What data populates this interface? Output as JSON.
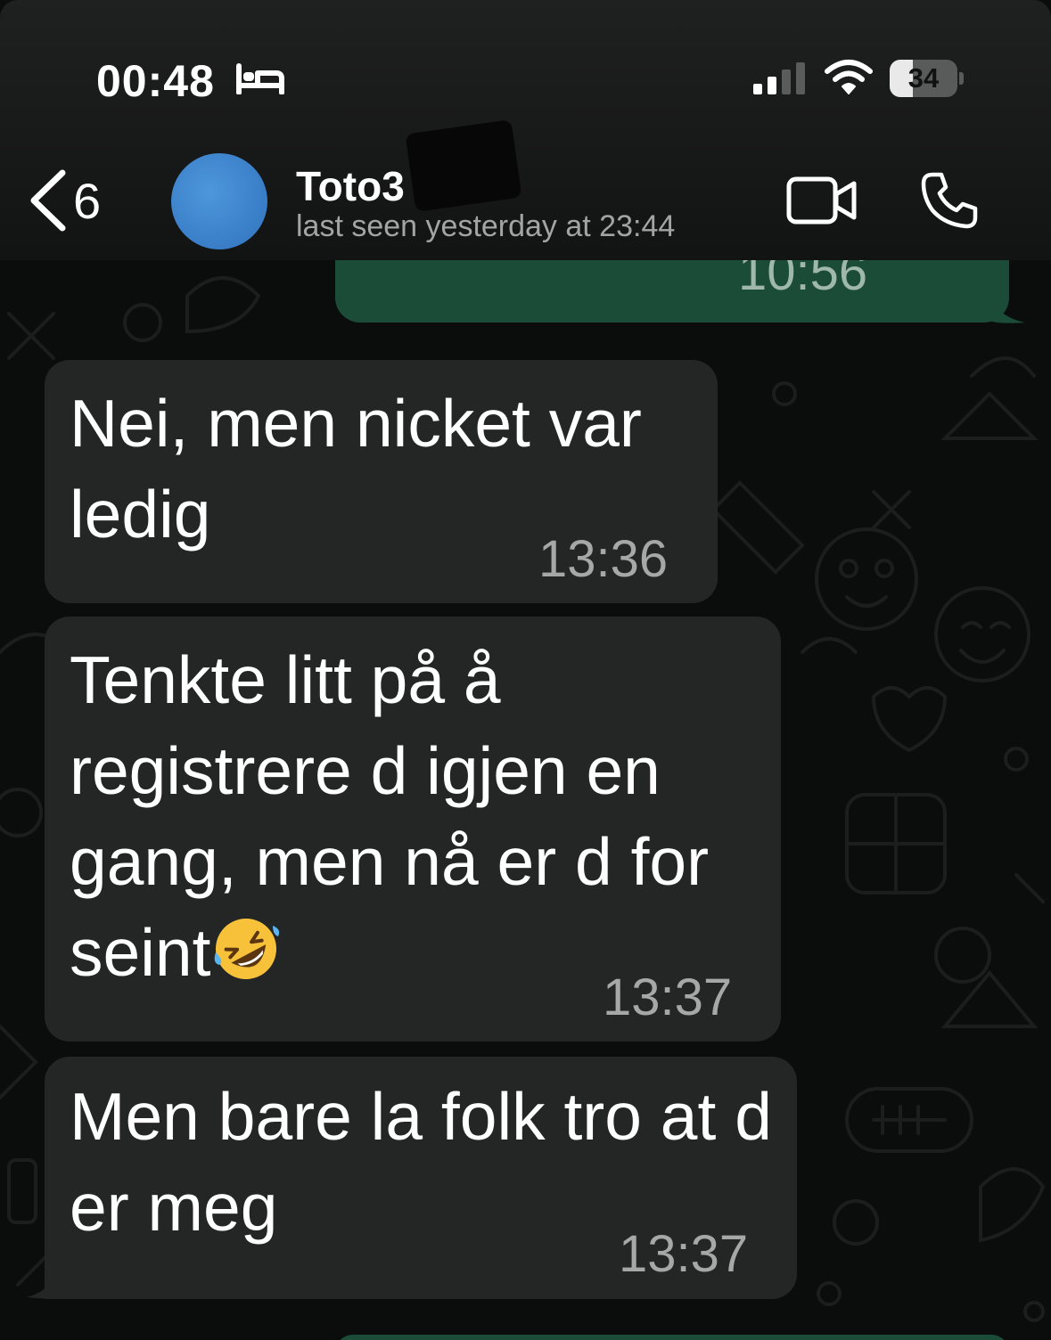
{
  "status_bar": {
    "time": "00:48",
    "battery": "34",
    "battery_level": 0.34,
    "icons": [
      "bed-icon",
      "cellular-signal-icon",
      "wifi-icon",
      "battery-icon"
    ]
  },
  "header": {
    "back_count": "6",
    "contact_name": "Toto3",
    "last_seen": "last seen yesterday at 23:44",
    "icons": [
      "back-chevron-icon",
      "video-call-icon",
      "voice-call-icon"
    ]
  },
  "messages": [
    {
      "direction": "outgoing",
      "text": "",
      "time": "10:56",
      "status": "read"
    },
    {
      "direction": "incoming",
      "text": "Nei, men nicket var ledig",
      "time": "13:36"
    },
    {
      "direction": "incoming",
      "text": "Tenkte litt på å registrere d igjen en gang, men nå er d for seint",
      "emoji": "rolling-on-the-floor-laughing",
      "time": "13:37"
    },
    {
      "direction": "incoming",
      "text": "Men bare la folk tro at d er meg",
      "time": "13:37"
    }
  ],
  "colors": {
    "incoming_bubble": "#242626",
    "outgoing_bubble": "#1b4c38",
    "read_ticks": "#53bdeb",
    "background": "#0b0c0c"
  }
}
